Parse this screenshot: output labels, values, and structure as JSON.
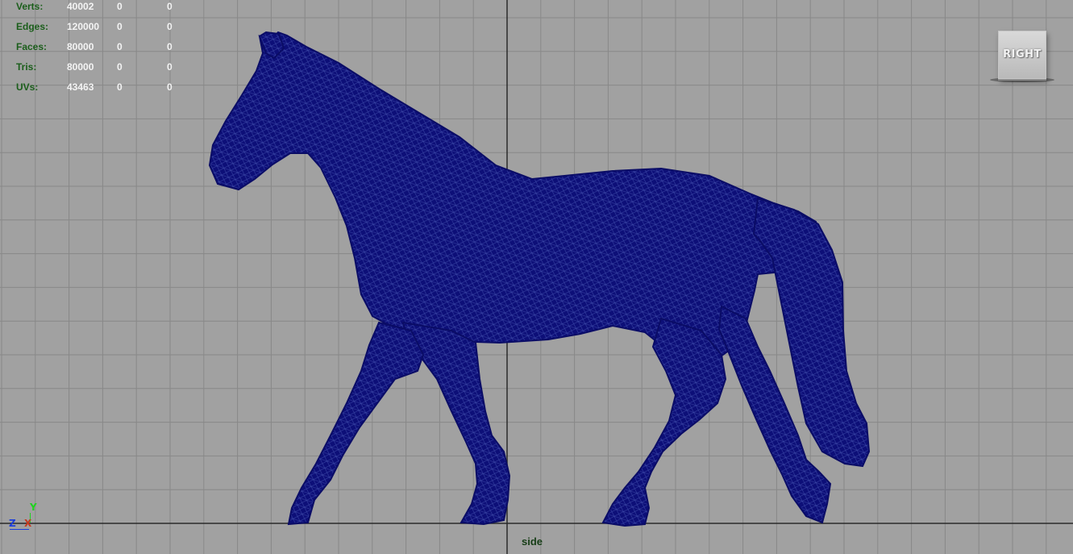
{
  "hud": {
    "rows": [
      {
        "label": "Verts:",
        "v1": "40002",
        "v2": "0",
        "v3": "0"
      },
      {
        "label": "Edges:",
        "v1": "120000",
        "v2": "0",
        "v3": "0"
      },
      {
        "label": "Faces:",
        "v1": "80000",
        "v2": "0",
        "v3": "0"
      },
      {
        "label": "Tris:",
        "v1": "80000",
        "v2": "0",
        "v3": "0"
      },
      {
        "label": "UVs:",
        "v1": "43463",
        "v2": "0",
        "v3": "0"
      }
    ]
  },
  "viewcube": {
    "face_label": "RIGHT"
  },
  "camera": {
    "name": "side"
  },
  "axes": {
    "y": "Y",
    "z": "Z",
    "x": "X"
  },
  "colors": {
    "background": "#a1a1a1",
    "grid_line": "#888888",
    "axis_line": "#2a2a2a",
    "mesh": "#0d0f78",
    "mesh_wire": "#3c49a8"
  }
}
